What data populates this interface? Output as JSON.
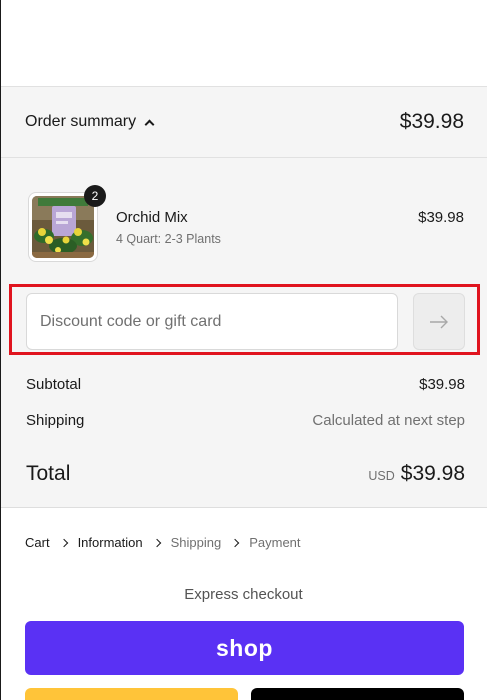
{
  "summary": {
    "toggle_label": "Order summary",
    "header_total": "$39.98"
  },
  "product": {
    "name": "Orchid Mix",
    "variant": "4 Quart: 2-3 Plants",
    "price": "$39.98",
    "quantity": "2",
    "image_icon": "plant-photo"
  },
  "discount": {
    "placeholder": "Discount code or gift card",
    "value": "",
    "apply_icon": "arrow-right-icon",
    "highlight_color": "#e0141e"
  },
  "totals": {
    "subtotal_label": "Subtotal",
    "subtotal_value": "$39.98",
    "shipping_label": "Shipping",
    "shipping_value": "Calculated at next step",
    "total_label": "Total",
    "currency": "USD",
    "total_value": "$39.98"
  },
  "breadcrumb": {
    "cart": "Cart",
    "information": "Information",
    "shipping": "Shipping",
    "payment": "Payment"
  },
  "express": {
    "title": "Express checkout",
    "shop_label": "shop",
    "shop_color": "#5a31f4",
    "paypal_color": "#ffc439",
    "gpay_color": "#000000"
  }
}
